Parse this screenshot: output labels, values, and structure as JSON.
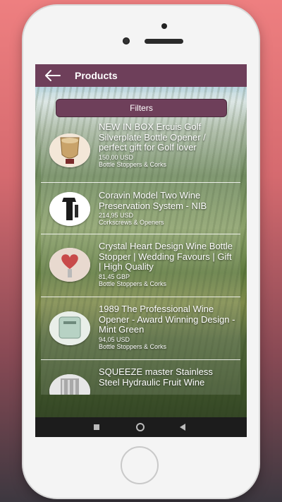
{
  "appbar": {
    "title": "Products"
  },
  "filters_label": "Filters",
  "products": [
    {
      "title": "NEW IN BOX Ercuis Golf Silverplate Bottle Opener / perfect gift for Golf lover",
      "price": "150,00 USD",
      "category": "Bottle Stoppers & Corks"
    },
    {
      "title": "Coravin Model Two Wine Preservation System - NIB",
      "price": "214,95 USD",
      "category": "Corkscrews & Openers"
    },
    {
      "title": "Crystal Heart Design Wine Bottle Stopper | Wedding Favours | Gift | High Quality",
      "price": "81,45 GBP",
      "category": "Bottle Stoppers & Corks"
    },
    {
      "title": "1989 The Professional Wine Opener - Award Winning Design - Mint Green",
      "price": "94,05 USD",
      "category": "Bottle Stoppers & Corks"
    },
    {
      "title": "SQUEEZE master Stainless Steel  Hydraulic Fruit Wine",
      "price": "",
      "category": ""
    }
  ],
  "icons": {
    "back": "arrow-left-icon",
    "nav_recents": "square-icon",
    "nav_home": "circle-icon",
    "nav_back": "triangle-back-icon"
  },
  "colors": {
    "appbar": "#6e3f5a",
    "filters_button": "#6e3f5a",
    "text": "#ffffff"
  }
}
